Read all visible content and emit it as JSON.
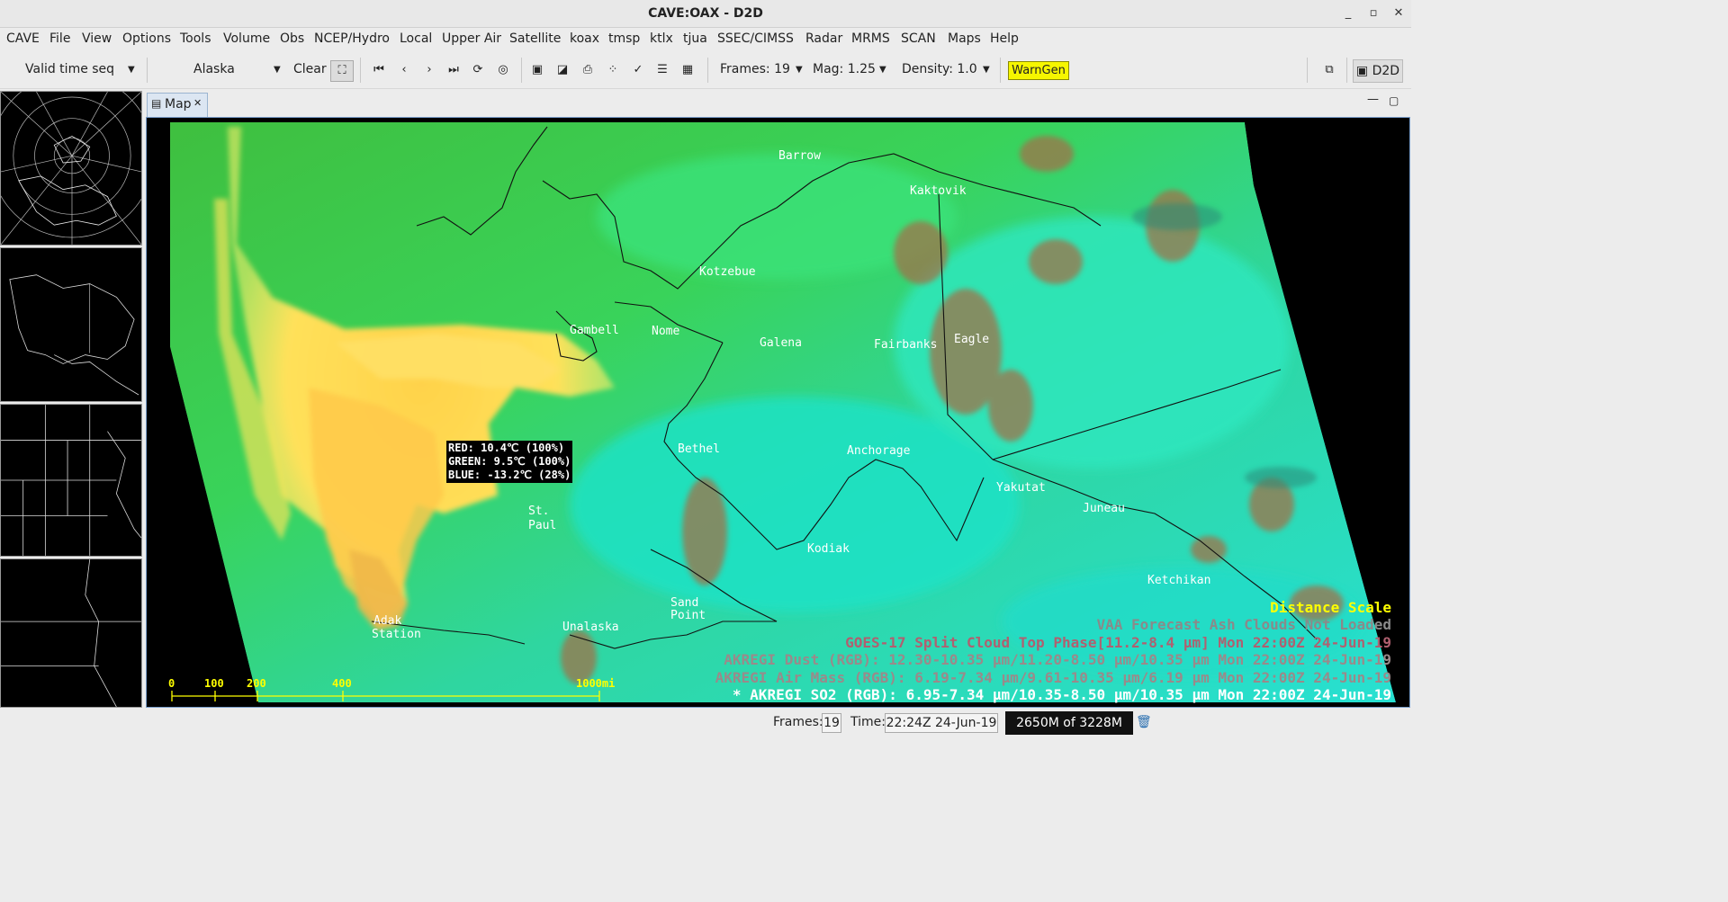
{
  "window": {
    "title": "CAVE:OAX - D2D",
    "minimize": "▫",
    "maximize": "▫",
    "close": "✕"
  },
  "menu": [
    "CAVE",
    "File",
    "View",
    "Options",
    "Tools",
    "Volume",
    "Obs",
    "NCEP/Hydro",
    "Local",
    "Upper Air",
    "Satellite",
    "koax",
    "tmsp",
    "ktlx",
    "tjua",
    "SSEC/CIMSS",
    "Radar",
    "MRMS",
    "SCAN",
    "Maps",
    "Help"
  ],
  "toolbar": {
    "time_mode": "Valid time seq",
    "scale": "Alaska",
    "clear": "Clear",
    "frames": "Frames: 19",
    "mag": "Mag: 1.25",
    "density": "Density: 1.0",
    "warngen": "WarnGen",
    "perspective": "D2D"
  },
  "tab": {
    "label": "Map"
  },
  "cities": [
    {
      "name": "Barrow"
    },
    {
      "name": "Kaktovik"
    },
    {
      "name": "Kotzebue"
    },
    {
      "name": "Gambell"
    },
    {
      "name": "Nome"
    },
    {
      "name": "Galena"
    },
    {
      "name": "Fairbanks"
    },
    {
      "name": "Eagle"
    },
    {
      "name": "Bethel"
    },
    {
      "name": "Anchorage"
    },
    {
      "name": "Yakutat"
    },
    {
      "name": "Juneau"
    },
    {
      "name": "St."
    },
    {
      "name": "Paul"
    },
    {
      "name": "Kodiak"
    },
    {
      "name": "Ketchikan"
    },
    {
      "name": "Sand"
    },
    {
      "name": "Point"
    },
    {
      "name": "Unalaska"
    },
    {
      "name": "Adak"
    },
    {
      "name": "Station"
    }
  ],
  "sample": {
    "red": "RED: 10.4℃ (100%)",
    "green": "GREEN: 9.5℃ (100%)",
    "blue": "BLUE: -13.2℃ (28%)"
  },
  "scale_bar": {
    "ticks": [
      "0",
      "100",
      "200",
      "400",
      "1000mi"
    ]
  },
  "legend": [
    {
      "text": "Distance Scale",
      "color": "#ffff00"
    },
    {
      "text": "VAA Forecast Ash Clouds Not Loaded",
      "color": "#8a8a8a"
    },
    {
      "text": "GOES-17 Split Cloud Top Phase[11.2-8.4 µm]  Mon 22:00Z 24-Jun-19",
      "color": "#b06070"
    },
    {
      "text": "AKREGI Dust (RGB): 12.30-10.35 µm/11.20-8.50 µm/10.35 µm Mon 22:00Z 24-Jun-19",
      "color": "#9a8a8a"
    },
    {
      "text": "AKREGI Air Mass (RGB): 6.19-7.34 µm/9.61-10.35 µm/6.19 µm Mon 22:00Z 24-Jun-19",
      "color": "#9a8a8a"
    },
    {
      "text": "* AKREGI SO2 (RGB): 6.95-7.34 µm/10.35-8.50 µm/10.35 µm Mon 22:00Z 24-Jun-19",
      "color": "#ffffff"
    }
  ],
  "status": {
    "frames_label": "Frames:",
    "frames_value": "19",
    "time_label": "Time:",
    "time_value": "22:24Z 24-Jun-19",
    "memory": "2650M of 3228M"
  }
}
